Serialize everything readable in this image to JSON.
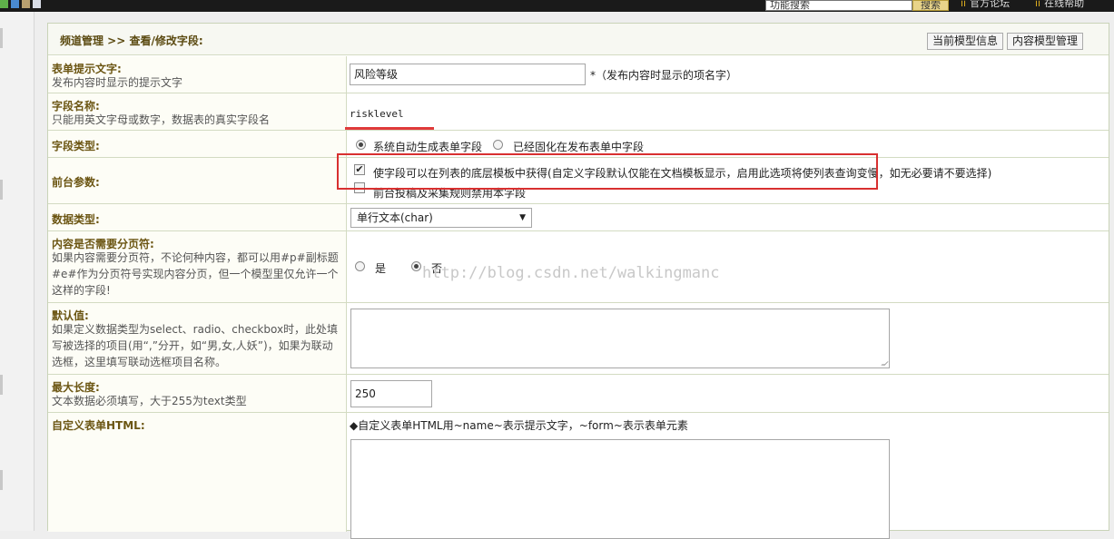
{
  "topbar": {
    "search_value": "功能搜索",
    "search_button": "搜索",
    "link_forum": "官方论坛",
    "link_help": "在线帮助"
  },
  "header": {
    "breadcrumb": "频道管理 >> 查看/修改字段:",
    "btn_model_info": "当前模型信息",
    "btn_model_manage": "内容模型管理"
  },
  "rows": {
    "form_prompt": {
      "title": "表单提示文字:",
      "desc": "发布内容时显示的提示文字",
      "value": "风险等级",
      "hint": "*（发布内容时显示的项名字）"
    },
    "field_name": {
      "title": "字段名称:",
      "desc": "只能用英文字母或数字，数据表的真实字段名",
      "value": "risklevel"
    },
    "field_type": {
      "title": "字段类型:",
      "options": [
        "系统自动生成表单字段",
        "已经固化在发布表单中字段"
      ],
      "selected": 0
    },
    "frontend": {
      "title": "前台参数:",
      "option1": "使字段可以在列表的底层模板中获得(自定义字段默认仅能在文档模板显示，启用此选项将使列表查询变慢，如无必要请不要选择)",
      "option1_checked": true,
      "option2": "前台投稿及采集规则禁用本字段",
      "option2_checked": false
    },
    "data_type": {
      "title": "数据类型:",
      "selected": "单行文本(char)"
    },
    "pagination": {
      "title": "内容是否需要分页符:",
      "desc": "如果内容需要分页符，不论何种内容，都可以用#p#副标题#e#作为分页符号实现内容分页，但一个模型里仅允许一个这样的字段!",
      "options": [
        "是",
        "否"
      ],
      "selected": 1
    },
    "default_value": {
      "title": "默认值:",
      "desc": "如果定义数据类型为select、radio、checkbox时，此处填写被选择的项目(用“,”分开，如“男,女,人妖”)，如果为联动选框，这里填写联动选框项目名称。",
      "value": ""
    },
    "max_length": {
      "title": "最大长度:",
      "desc": "文本数据必须填写，大于255为text类型",
      "value": "250"
    },
    "custom_html": {
      "title": "自定义表单HTML:",
      "hint": "◆自定义表单HTML用~name~表示提示文字，~form~表示表单元素",
      "value": ""
    }
  },
  "watermark": "http://blog.csdn.net/walkingmanc"
}
